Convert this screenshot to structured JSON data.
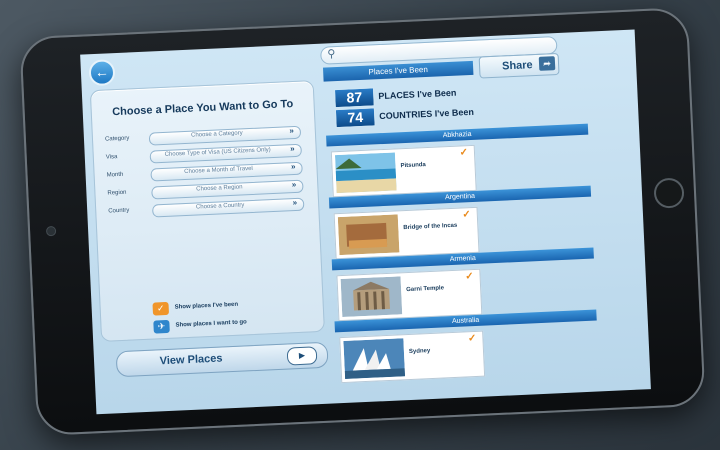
{
  "header": {
    "back_icon": "back-arrow-icon",
    "search_placeholder": "",
    "places_tab": "Places I've Been",
    "share_label": "Share",
    "share_icon": "share-icon"
  },
  "form": {
    "title": "Choose a Place You Want to Go To",
    "fields": [
      {
        "label": "Category",
        "value": "Choose a Category"
      },
      {
        "label": "Visa",
        "value": "Choose Type of Visa (US Citizens Only)"
      },
      {
        "label": "Month",
        "value": "Choose a Month of Travel"
      },
      {
        "label": "Region",
        "value": "Choose a Region"
      },
      {
        "label": "Country",
        "value": "Choose a Country"
      }
    ],
    "options": [
      {
        "label": "Show places I've been",
        "icon": "checkmark-icon",
        "color": "#f0952a"
      },
      {
        "label": "Show places I want to go",
        "icon": "airplane-icon",
        "color": "#2f86cc"
      }
    ],
    "view_button": "View Places"
  },
  "stats": {
    "places_count": "87",
    "places_label": "PLACES I've Been",
    "countries_count": "74",
    "countries_label": "COUNTRIES I've Been"
  },
  "list": [
    {
      "country": "Abkhazia",
      "place": "Pitsunda",
      "thumb": "beach"
    },
    {
      "country": "Argentina",
      "place": "Bridge of the Incas",
      "thumb": "rock"
    },
    {
      "country": "Armenia",
      "place": "Garni Temple",
      "thumb": "temple"
    },
    {
      "country": "Australia",
      "place": "Sydney",
      "thumb": "opera"
    }
  ],
  "colors": {
    "accent": "#1b64ad",
    "checkmark": "#e98a1c"
  }
}
